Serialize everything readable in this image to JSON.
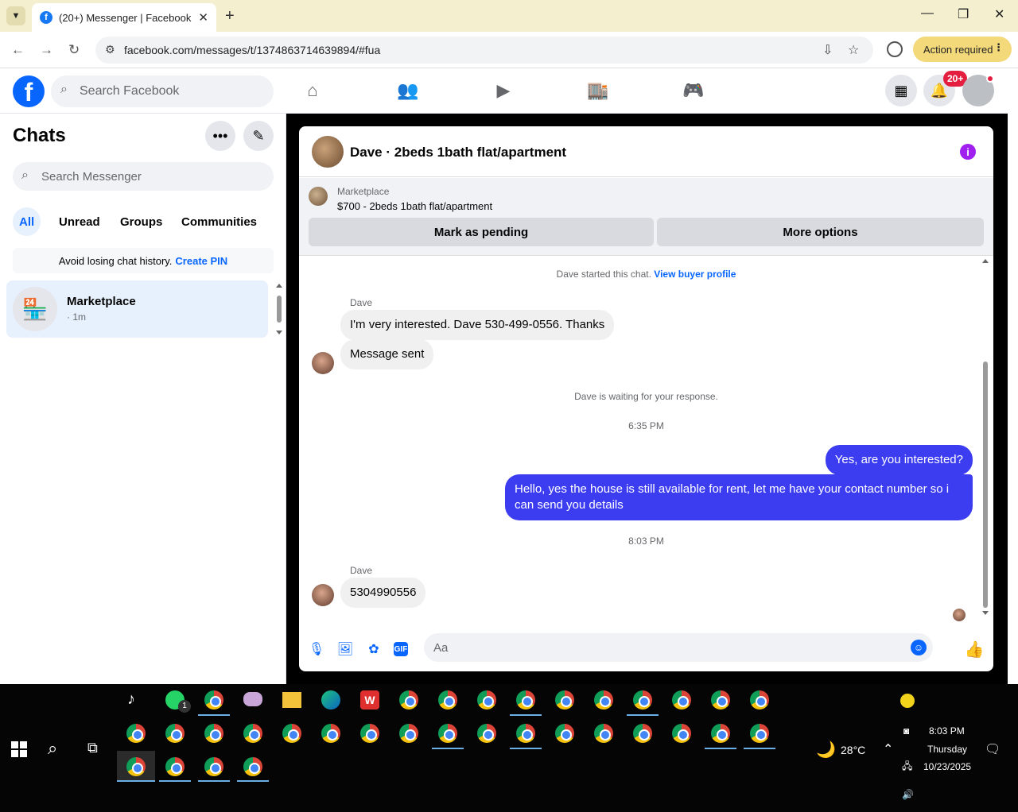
{
  "browser": {
    "tab_title": "(20+) Messenger | Facebook",
    "url": "facebook.com/messages/t/1374863714639894/#fua",
    "action_label": "Action required"
  },
  "facebook": {
    "search_placeholder": "Search Facebook",
    "notification_badge": "20+"
  },
  "sidebar": {
    "title": "Chats",
    "search_placeholder": "Search Messenger",
    "filters": [
      "All",
      "Unread",
      "Groups",
      "Communities"
    ],
    "pin_notice": "Avoid losing chat history.",
    "pin_link": "Create PIN",
    "chats": [
      {
        "name": "Marketplace",
        "time": "· 1m"
      }
    ]
  },
  "chat": {
    "title": "Dave · 2beds 1bath flat/apartment",
    "listing_source": "Marketplace",
    "listing_title": "$700 - 2beds 1bath flat/apartment",
    "mark_pending": "Mark as pending",
    "more_options": "More options",
    "started_text": "Dave started this chat.",
    "buyer_profile_link": "View buyer profile",
    "messages": [
      {
        "sender": "Dave",
        "text": "I'm very interested.  Dave 530-499-0556. Thanks",
        "direction": "in"
      },
      {
        "text": "Message sent",
        "direction": "in"
      },
      {
        "system": "Dave is waiting for your response."
      },
      {
        "time": "6:35 PM"
      },
      {
        "text": "Yes, are you interested?",
        "direction": "out"
      },
      {
        "text": "Hello, yes the house is still available for rent, let me have your contact number so i can send you details",
        "direction": "out"
      },
      {
        "time": "8:03 PM"
      },
      {
        "sender": "Dave",
        "text": "5304990556",
        "direction": "in"
      }
    ],
    "input_placeholder": "Aa"
  },
  "taskbar": {
    "whatsapp_badge": "1",
    "weather_temp": "28°C",
    "time": "8:03 PM",
    "day": "Thursday",
    "date": "10/23/2025"
  },
  "colors": {
    "facebook_blue": "#0866ff",
    "outgoing_bubble": "#3c3cf0",
    "badge_red": "#e41e3f",
    "info_purple": "#a020f0"
  }
}
